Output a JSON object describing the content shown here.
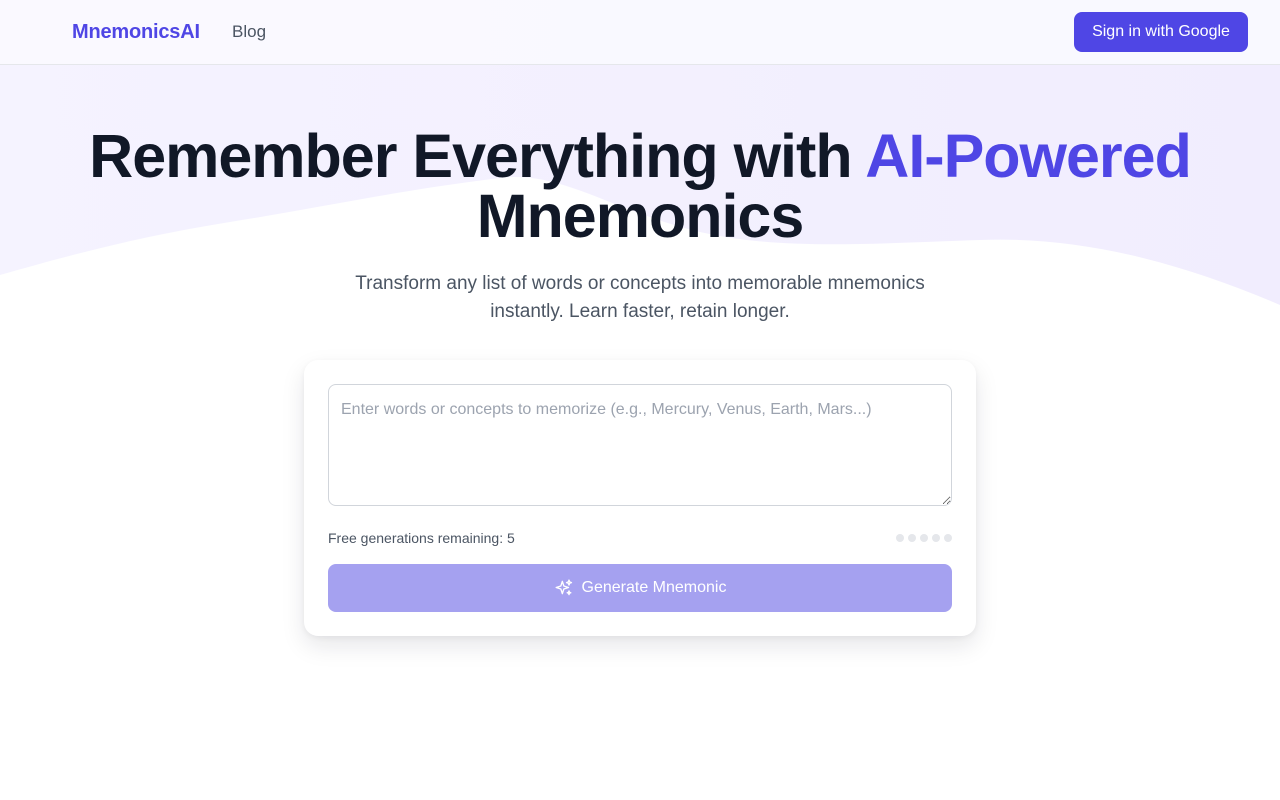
{
  "header": {
    "logo": "MnemonicsAI",
    "nav": [
      {
        "label": "Blog"
      }
    ],
    "signin_label": "Sign in with Google"
  },
  "hero": {
    "title_main": "Remember Everything with ",
    "title_accent": "AI-Powered",
    "title_end": "Mnemonics",
    "subtitle_line1": "Transform any list of words or concepts into memorable mnemonics",
    "subtitle_line2": "instantly. Learn faster, retain longer."
  },
  "generator": {
    "input_placeholder": "Enter words or concepts to memorize (e.g., Mercury, Venus, Earth, Mars...)",
    "input_value": "",
    "remaining_label": "Free generations remaining: 5",
    "remaining_count": 5,
    "button_label": "Generate Mnemonic",
    "button_icon": "sparkles-icon"
  },
  "colors": {
    "brand": "#4f46e5",
    "button_disabled": "#a5a1f0",
    "dot_inactive": "#e5e7eb",
    "text_muted": "#4b5563"
  }
}
